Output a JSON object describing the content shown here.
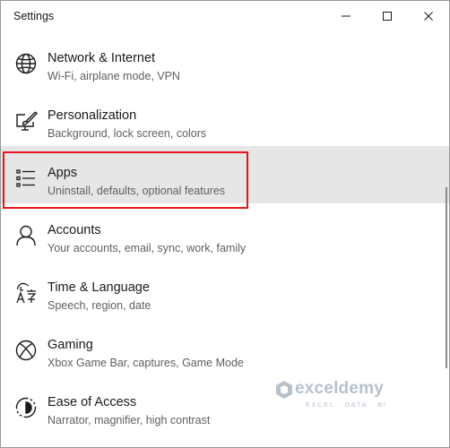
{
  "window": {
    "title": "Settings"
  },
  "items": [
    {
      "label": "Network & Internet",
      "description": "Wi-Fi, airplane mode, VPN",
      "icon": "globe-icon"
    },
    {
      "label": "Personalization",
      "description": "Background, lock screen, colors",
      "icon": "paint-brush-icon"
    },
    {
      "label": "Apps",
      "description": "Uninstall, defaults, optional features",
      "icon": "apps-list-icon",
      "selected": true
    },
    {
      "label": "Accounts",
      "description": "Your accounts, email, sync, work, family",
      "icon": "person-icon"
    },
    {
      "label": "Time & Language",
      "description": "Speech, region, date",
      "icon": "time-language-icon"
    },
    {
      "label": "Gaming",
      "description": "Xbox Game Bar, captures, Game Mode",
      "icon": "xbox-icon"
    },
    {
      "label": "Ease of Access",
      "description": "Narrator, magnifier, high contrast",
      "icon": "ease-of-access-icon"
    }
  ],
  "watermark": {
    "name": "exceldemy",
    "tagline": "EXCEL · DATA · BI"
  },
  "colors": {
    "selected_background": "#e6e6e6",
    "highlight_border": "#e8141b"
  }
}
